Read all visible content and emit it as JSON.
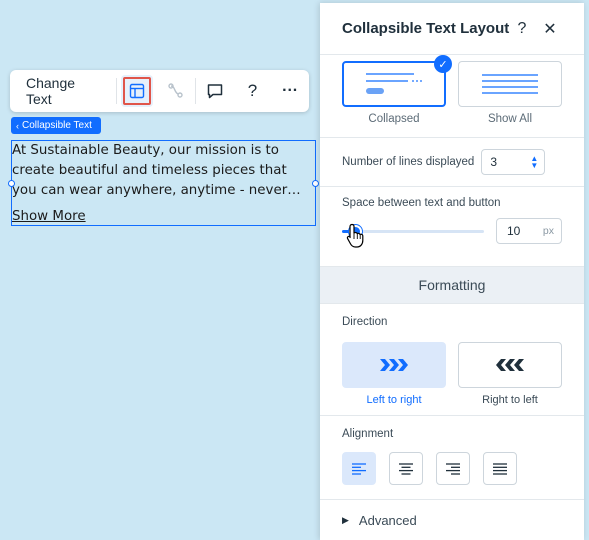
{
  "toolbar": {
    "change_text_label": "Change Text",
    "icons": [
      "layout-icon",
      "link-icon",
      "comment-icon",
      "help-icon",
      "more-icon"
    ],
    "help_glyph": "?",
    "more_glyph": "···"
  },
  "element_tag": {
    "label": "Collapsible Text"
  },
  "text_element": {
    "paragraph": "At Sustainable Beauty, our mission is to create beautiful and timeless pieces that you can wear anywhere, anytime - never going out of style, and always made with care for the planet.",
    "show_more_label": "Show More"
  },
  "panel": {
    "title": "Collapsible Text Layout",
    "help_glyph": "?",
    "close_glyph": "✕",
    "layouts": [
      {
        "label": "Collapsed",
        "selected": true
      },
      {
        "label": "Show All",
        "selected": false
      }
    ],
    "lines_label": "Number of lines displayed",
    "lines_value": "3",
    "spacing_label": "Space between text and button",
    "spacing_value": "10",
    "spacing_unit": "px",
    "spacing_fraction": 0.09,
    "formatting_label": "Formatting",
    "direction_label": "Direction",
    "directions": [
      {
        "label": "Left to right",
        "selected": true
      },
      {
        "label": "Right to left",
        "selected": false
      }
    ],
    "alignment_label": "Alignment",
    "alignments": [
      "align-left-icon",
      "align-center-icon",
      "align-right-icon",
      "align-justify-icon"
    ],
    "selected_alignment": 0,
    "advanced_label": "Advanced"
  },
  "colors": {
    "accent": "#116dff",
    "canvas": "#cbe7f4",
    "highlight": "#e0554a"
  }
}
